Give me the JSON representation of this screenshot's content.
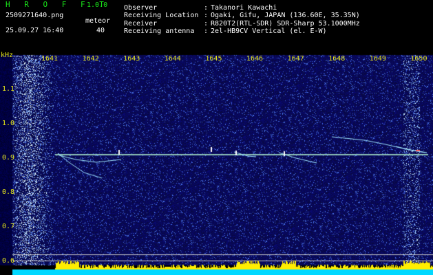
{
  "header": {
    "app_title": "H R O F F T",
    "app_version": "1.0.0",
    "file_name": "2509271640.png",
    "capture_time": "25.09.27 16:40",
    "count_label": "meteor",
    "count_value": "40",
    "meta": [
      {
        "key": "Observer",
        "sep": ":",
        "value": "Takanori Kawachi"
      },
      {
        "key": "Receiving Location",
        "sep": ":",
        "value": "Ogaki, Gifu, JAPAN (136.60E, 35.35N)"
      },
      {
        "key": "Receiver",
        "sep": ":",
        "value": "R820T2(RTL-SDR) SDR-Sharp 53.1000MHz"
      },
      {
        "key": "Receiving antenna",
        "sep": ":",
        "value": "2el-HB9CV Vertical (el. E-W)"
      }
    ]
  },
  "axes": {
    "y_unit": "kHz",
    "time_ticks": [
      "1641",
      "1642",
      "1643",
      "1644",
      "1645",
      "1646",
      "1647",
      "1648",
      "1649",
      "1650"
    ],
    "freq_ticks": [
      "1.1",
      "1.0",
      "0.9",
      "0.8",
      "0.7",
      "0.6"
    ],
    "freq_tick_values": [
      1.1,
      1.0,
      0.9,
      0.8,
      0.7,
      0.6
    ]
  },
  "colors": {
    "background": "#000000",
    "noise_base": "#12127a",
    "carrier": "#b8ffd6",
    "label_yellow": "#e6e619",
    "label_green": "#19e619",
    "activity_yellow": "#ffee00",
    "activity_cyan": "#00d8ff"
  }
}
